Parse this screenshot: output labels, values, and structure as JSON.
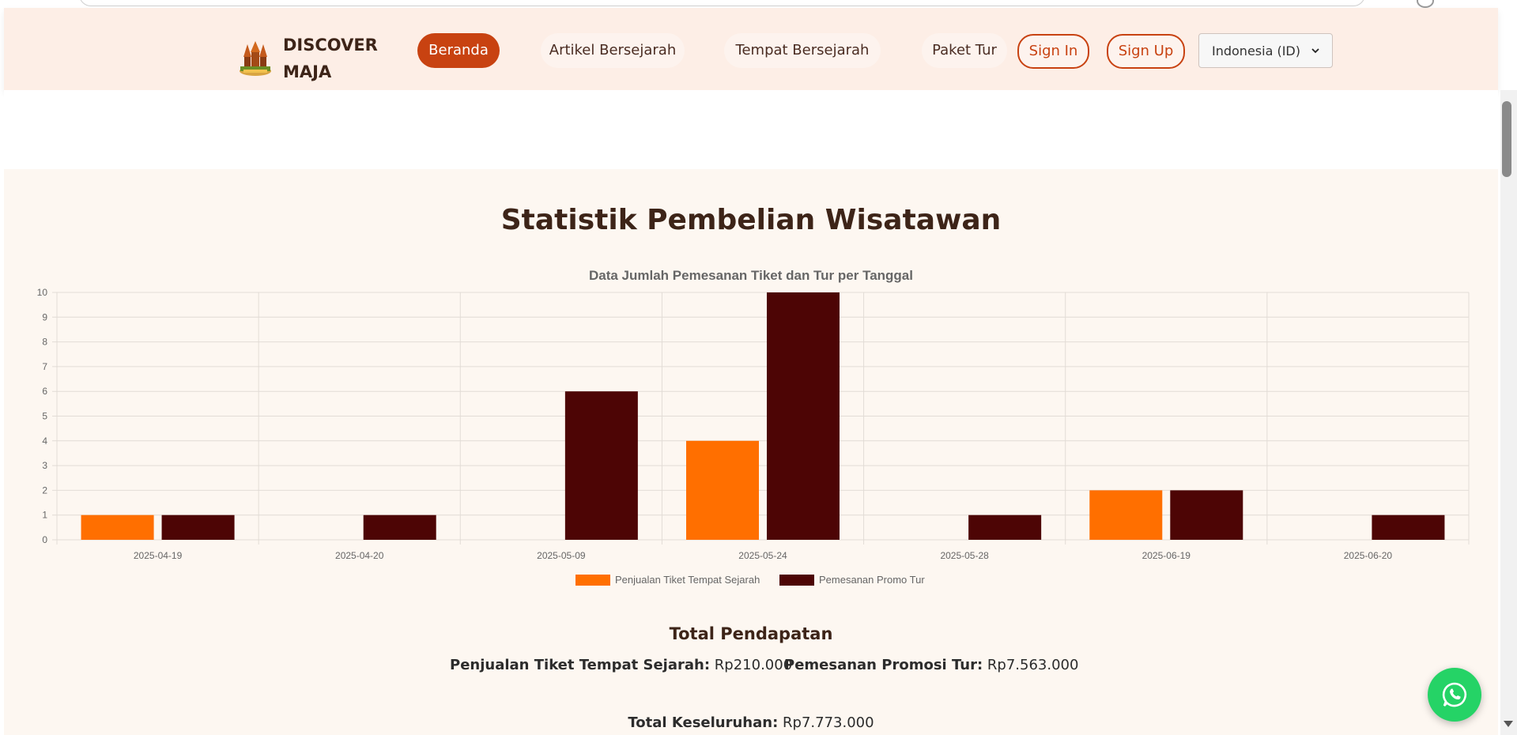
{
  "nav": {
    "brand_line1": "DISCOVER",
    "brand_line2": "MAJA",
    "items": [
      {
        "label": "Beranda",
        "active": true
      },
      {
        "label": "Artikel Bersejarah",
        "active": false
      },
      {
        "label": "Tempat Bersejarah",
        "active": false
      },
      {
        "label": "Paket Tur",
        "active": false
      }
    ],
    "sign_in": "Sign In",
    "sign_up": "Sign Up",
    "language": "Indonesia (ID)"
  },
  "stats": {
    "title": "Statistik Pembelian Wisatawan"
  },
  "chart_data": {
    "type": "bar",
    "title": "Data Jumlah Pemesanan Tiket dan Tur per Tanggal",
    "categories": [
      "2025-04-19",
      "2025-04-20",
      "2025-05-09",
      "2025-05-24",
      "2025-05-28",
      "2025-06-19",
      "2025-06-20"
    ],
    "series": [
      {
        "name": "Penjualan Tiket Tempat Sejarah",
        "color": "#ff6f00",
        "values": [
          1,
          0,
          0,
          4,
          0,
          2,
          0
        ]
      },
      {
        "name": "Pemesanan Promo Tur",
        "color": "#4d0505",
        "values": [
          1,
          1,
          6,
          10,
          1,
          2,
          1
        ]
      }
    ],
    "ylim": [
      0,
      10
    ],
    "yticks": [
      0,
      1,
      2,
      3,
      4,
      5,
      6,
      7,
      8,
      9,
      10
    ],
    "grid": true,
    "legend": "bottom"
  },
  "revenue": {
    "title": "Total Pendapatan",
    "ticket_label": "Penjualan Tiket Tempat Sejarah:",
    "ticket_value": "Rp210.000",
    "promo_label": "Pemesanan Promosi Tur:",
    "promo_value": "Rp7.563.000",
    "total_label": "Total Keseluruhan:",
    "total_value": "Rp7.773.000"
  },
  "colors": {
    "accent": "#c84211",
    "navbar_bg": "#fdeee6",
    "section_bg": "#fdf7f1",
    "whatsapp": "#25d366"
  }
}
